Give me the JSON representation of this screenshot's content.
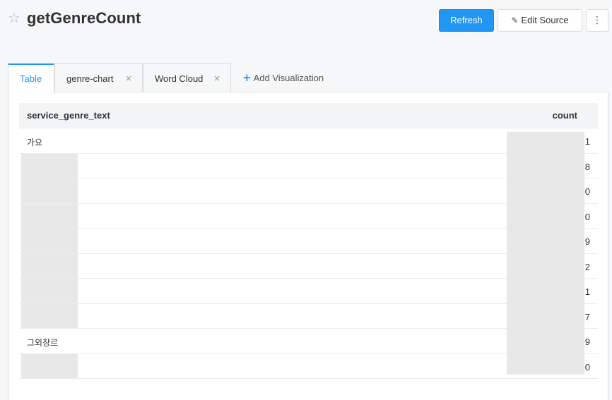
{
  "header": {
    "title": "getGenreCount",
    "refresh_label": "Refresh",
    "edit_source_label": "Edit Source",
    "more_label": "⋮",
    "star_icon": "star-outline-icon"
  },
  "tabs": {
    "items": [
      {
        "label": "Table",
        "active": true,
        "closable": false
      },
      {
        "label": "genre-chart",
        "active": false,
        "closable": true
      },
      {
        "label": "Word Cloud",
        "active": false,
        "closable": true
      }
    ],
    "close_glyph": "×",
    "add_label": "Add Visualization",
    "add_glyph": "+"
  },
  "table": {
    "columns": [
      "service_genre_text",
      "count"
    ],
    "rows": [
      {
        "genre": "가요",
        "count": "1",
        "genre_redacted": false
      },
      {
        "genre": "",
        "count": "8",
        "genre_redacted": true
      },
      {
        "genre": "",
        "count": "0",
        "genre_redacted": true
      },
      {
        "genre": "",
        "count": "0",
        "genre_redacted": true
      },
      {
        "genre": "",
        "count": "9",
        "genre_redacted": true
      },
      {
        "genre": "",
        "count": "2",
        "genre_redacted": true
      },
      {
        "genre": "",
        "count": "1",
        "genre_redacted": true
      },
      {
        "genre": "",
        "count": "7",
        "genre_redacted": true
      },
      {
        "genre": "그외장르",
        "count": "9",
        "genre_redacted": false
      },
      {
        "genre": "",
        "count": "0",
        "genre_redacted": true
      }
    ]
  },
  "colors": {
    "accent": "#2196f3",
    "redaction": "#e8e8e8"
  }
}
